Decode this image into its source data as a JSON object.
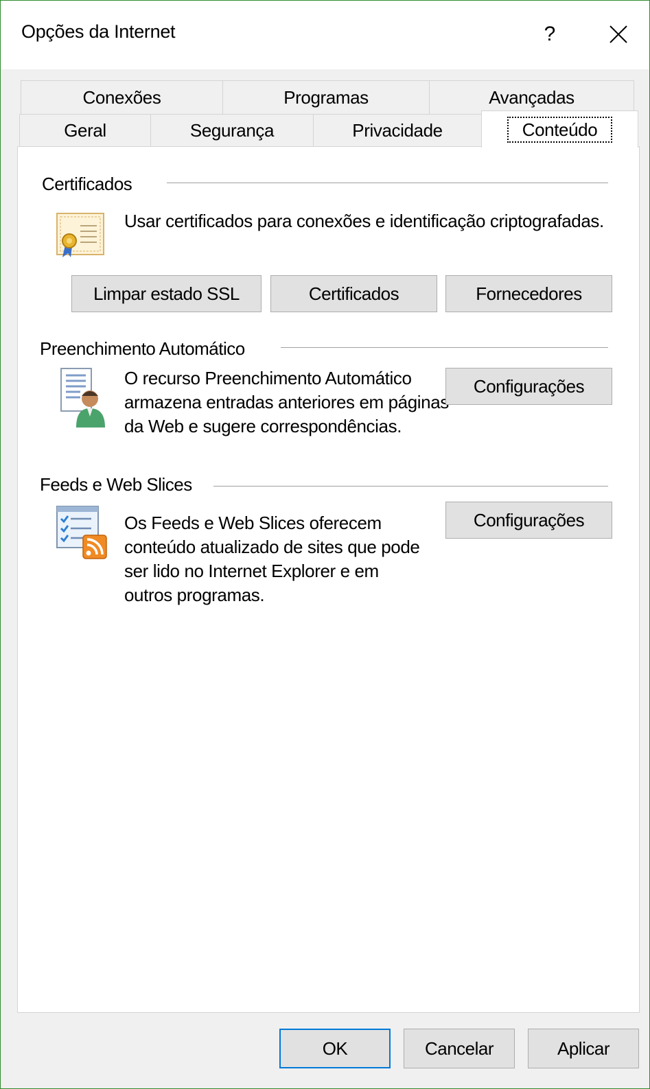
{
  "window": {
    "title": "Opções da Internet",
    "help_label": "?"
  },
  "tabs": {
    "row1": [
      "Conexões",
      "Programas",
      "Avançadas"
    ],
    "row2": [
      "Geral",
      "Segurança",
      "Privacidade",
      "Conteúdo"
    ],
    "active": "Conteúdo"
  },
  "certificates": {
    "heading": "Certificados",
    "description": "Usar certificados para conexões e identificação criptografadas.",
    "buttons": {
      "clear_ssl": "Limpar estado SSL",
      "certificates": "Certificados",
      "publishers": "Fornecedores"
    }
  },
  "autocomplete": {
    "heading": "Preenchimento Automático",
    "description_lines": [
      "O recurso Preenchimento Automático",
      "armazena entradas anteriores em páginas",
      "da Web e sugere correspondências."
    ],
    "settings_button": "Configurações"
  },
  "feeds": {
    "heading": "Feeds e Web Slices",
    "description_lines": [
      "Os Feeds e Web Slices oferecem",
      "conteúdo atualizado de sites que pode",
      "ser lido no Internet Explorer e em",
      "outros programas."
    ],
    "settings_button": "Configurações"
  },
  "footer": {
    "ok": "OK",
    "cancel": "Cancelar",
    "apply": "Aplicar"
  },
  "colors": {
    "window_border": "#2e8b2e",
    "default_button_border": "#0078d7",
    "button_face": "#e1e1e1",
    "rss_orange": "#f08a24"
  }
}
